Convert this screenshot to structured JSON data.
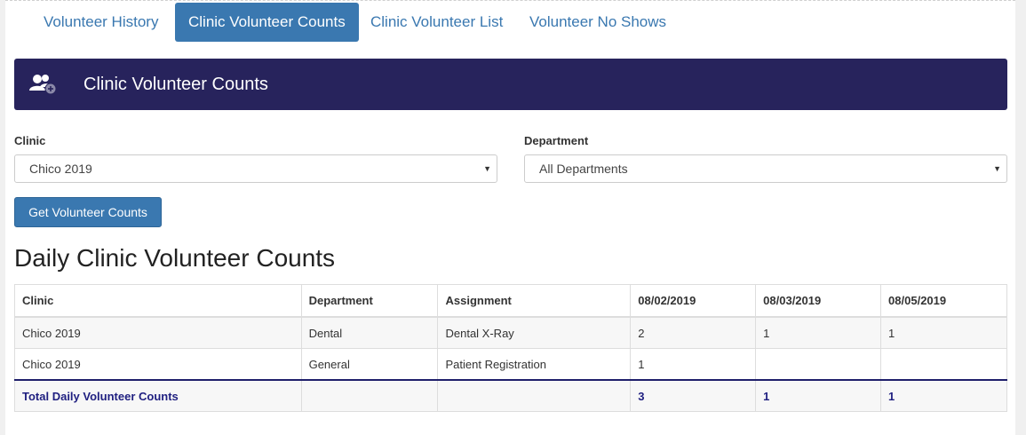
{
  "tabs": [
    {
      "label": "Volunteer History",
      "active": false
    },
    {
      "label": "Clinic Volunteer Counts",
      "active": true
    },
    {
      "label": "Clinic Volunteer List",
      "active": false
    },
    {
      "label": "Volunteer No Shows",
      "active": false
    }
  ],
  "banner": {
    "title": "Clinic Volunteer Counts",
    "icon": "users-add-icon",
    "color": "#27235c"
  },
  "form": {
    "clinic_label": "Clinic",
    "clinic_value": "Chico 2019",
    "department_label": "Department",
    "department_value": "All Departments",
    "submit_label": "Get Volunteer Counts"
  },
  "results": {
    "heading": "Daily Clinic Volunteer Counts",
    "columns": [
      "Clinic",
      "Department",
      "Assignment",
      "08/02/2019",
      "08/03/2019",
      "08/05/2019"
    ],
    "rows": [
      [
        "Chico 2019",
        "Dental",
        "Dental X-Ray",
        "2",
        "1",
        "1"
      ],
      [
        "Chico 2019",
        "General",
        "Patient Registration",
        "1",
        "",
        ""
      ]
    ],
    "total": [
      "Total Daily Volunteer Counts",
      "",
      "",
      "3",
      "1",
      "1"
    ]
  },
  "colors": {
    "accent": "#3a78b0",
    "banner": "#27235c",
    "total_text": "#1f1f80"
  }
}
